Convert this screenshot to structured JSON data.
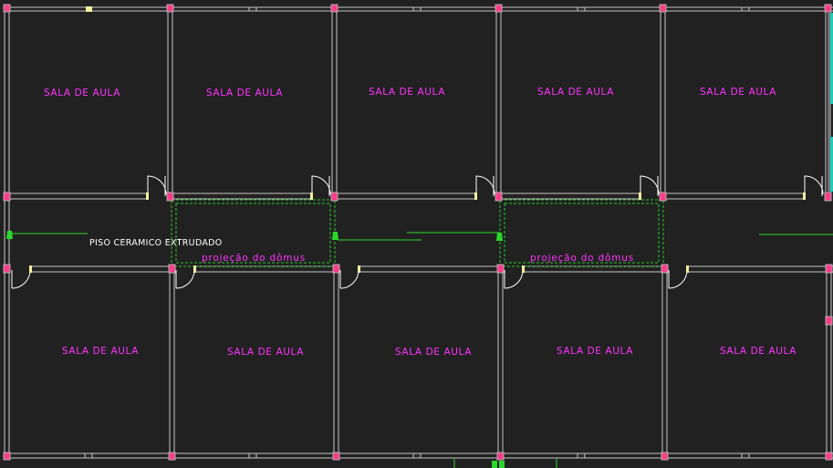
{
  "drawing": {
    "rooms_top": [
      {
        "label": "SALA DE AULA"
      },
      {
        "label": "SALA DE AULA"
      },
      {
        "label": "SALA DE AULA"
      },
      {
        "label": "SALA DE AULA"
      },
      {
        "label": "SALA DE AULA"
      }
    ],
    "rooms_bottom": [
      {
        "label": "SALA DE AULA"
      },
      {
        "label": "SALA DE AULA"
      },
      {
        "label": "SALA DE AULA"
      },
      {
        "label": "SALA DE AULA"
      },
      {
        "label": "SALA DE AULA"
      }
    ],
    "corridor": {
      "floor_note": "PISO CERAMICO EXTRUDADO",
      "skylights": [
        {
          "label": "projeção do dômus"
        },
        {
          "label": "projeção do dômus"
        }
      ]
    }
  },
  "colors": {
    "background": "#212121",
    "wall": "#c8c8c8",
    "room_label": "#ff33ff",
    "column": "#ff3c8a",
    "note": "#ffffff",
    "skylight": "#22cc22",
    "guide_line": "#2dd62d",
    "door": "#ffffff",
    "sill": "#f2eea0",
    "edge_accent": "#22c9b8"
  }
}
